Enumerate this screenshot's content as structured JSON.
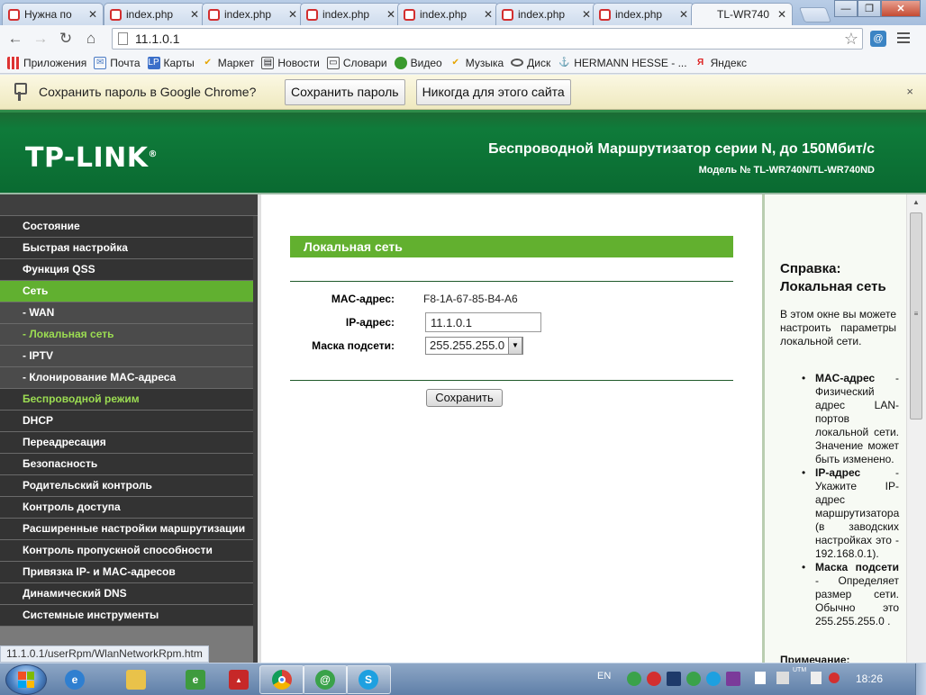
{
  "browser": {
    "tabs": [
      {
        "title": "Нужна по"
      },
      {
        "title": "index.php"
      },
      {
        "title": "index.php"
      },
      {
        "title": "index.php"
      },
      {
        "title": "index.php"
      },
      {
        "title": "index.php"
      },
      {
        "title": "index.php"
      },
      {
        "title": "TL-WR740"
      }
    ],
    "active_tab_index": 7,
    "url": "11.1.0.1",
    "bookmarks": [
      {
        "label": "Приложения",
        "icon": "apps-grid-icon"
      },
      {
        "label": "Почта",
        "icon": "mail-icon"
      },
      {
        "label": "Карты",
        "icon": "maps-icon"
      },
      {
        "label": "Маркет",
        "icon": "market-icon"
      },
      {
        "label": "Новости",
        "icon": "news-icon"
      },
      {
        "label": "Словари",
        "icon": "dictionary-icon"
      },
      {
        "label": "Видео",
        "icon": "video-icon"
      },
      {
        "label": "Музыка",
        "icon": "music-icon"
      },
      {
        "label": "Диск",
        "icon": "disk-icon"
      },
      {
        "label": "HERMANN HESSE - ...",
        "icon": "ship-icon"
      },
      {
        "label": "Яндекс",
        "icon": "yandex-icon"
      }
    ]
  },
  "infobar": {
    "message": "Сохранить пароль в Google Chrome?",
    "save_button": "Сохранить пароль",
    "never_button": "Никогда для этого сайта",
    "close": "×"
  },
  "router": {
    "brand": "TP-LINK",
    "title": "Беспроводной Маршрутизатор серии N, до 150Мбит/с",
    "model": "Модель № TL-WR740N/TL-WR740ND",
    "menu": [
      {
        "label": "Состояние",
        "type": "item"
      },
      {
        "label": "Быстрая настройка",
        "type": "item"
      },
      {
        "label": "Функция QSS",
        "type": "item"
      },
      {
        "label": "Сеть",
        "type": "active"
      },
      {
        "label": "- WAN",
        "type": "sub"
      },
      {
        "label": "- Локальная сеть",
        "type": "current"
      },
      {
        "label": "- IPTV",
        "type": "sub"
      },
      {
        "label": "- Клонирование MAC-адреса",
        "type": "sub"
      },
      {
        "label": "Беспроводной режим",
        "type": "section"
      },
      {
        "label": "DHCP",
        "type": "item"
      },
      {
        "label": "Переадресация",
        "type": "item"
      },
      {
        "label": "Безопасность",
        "type": "item"
      },
      {
        "label": "Родительский контроль",
        "type": "item"
      },
      {
        "label": "Контроль доступа",
        "type": "item"
      },
      {
        "label": "Расширенные настройки маршрутизации",
        "type": "item"
      },
      {
        "label": "Контроль пропускной способности",
        "type": "item"
      },
      {
        "label": "Привязка IP- и MAC-адресов",
        "type": "item"
      },
      {
        "label": "Динамический DNS",
        "type": "item"
      },
      {
        "label": "Системные инструменты",
        "type": "item"
      }
    ],
    "page": {
      "title": "Локальная сеть",
      "mac_label": "MAC-адрес:",
      "mac_value": "F8-1A-67-85-B4-A6",
      "ip_label": "IP-адрес:",
      "ip_value": "11.1.0.1",
      "mask_label": "Маска подсети:",
      "mask_value": "255.255.255.0",
      "save": "Сохранить"
    },
    "help": {
      "title_line1": "Справка:",
      "title_line2": "Локальная сеть",
      "intro": "В этом окне вы можете настроить параметры локальной сети.",
      "items": [
        {
          "term": "MAC-адрес",
          "text": " - Физический адрес LAN-портов локальной сети. Значение может быть изменено."
        },
        {
          "term": "IP-адрес",
          "text": " - Укажите IP-адрес маршрутизатора (в заводских настройках это - 192.168.0.1)."
        },
        {
          "term": "Маска подсети",
          "text": " - Определяет размер сети. Обычно это 255.255.255.0 ."
        }
      ],
      "note": "Примечание:"
    }
  },
  "status_url": "11.1.0.1/userRpm/WlanNetworkRpm.htm",
  "taskbar": {
    "lang": "EN",
    "clock": "18:26",
    "utm": "UTM"
  }
}
